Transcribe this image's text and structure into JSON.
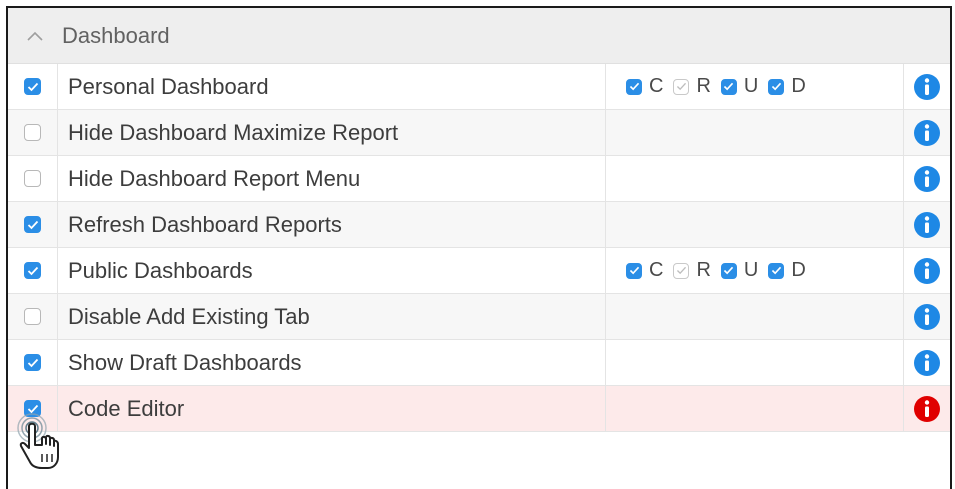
{
  "header": {
    "title": "Dashboard"
  },
  "crud_letters": {
    "c": "C",
    "r": "R",
    "u": "U",
    "d": "D"
  },
  "colors": {
    "accent": "#2b8ee6",
    "info": "#1e88e5",
    "alert": "#e00000",
    "highlight_row": "#fdeaea"
  },
  "rows": [
    {
      "label": "Personal Dashboard",
      "checked": true,
      "crud": {
        "c": true,
        "r": "disabled-checked",
        "u": true,
        "d": true
      },
      "info": "info"
    },
    {
      "label": "Hide Dashboard Maximize Report",
      "checked": false,
      "info": "info"
    },
    {
      "label": "Hide Dashboard Report Menu",
      "checked": false,
      "info": "info"
    },
    {
      "label": "Refresh Dashboard Reports",
      "checked": true,
      "info": "info"
    },
    {
      "label": "Public Dashboards",
      "checked": true,
      "crud": {
        "c": true,
        "r": "disabled-checked",
        "u": true,
        "d": true
      },
      "info": "info"
    },
    {
      "label": "Disable Add Existing Tab",
      "checked": false,
      "info": "info"
    },
    {
      "label": "Show Draft Dashboards",
      "checked": true,
      "info": "info"
    },
    {
      "label": "Code Editor",
      "checked": true,
      "info": "alert",
      "highlight": true
    }
  ]
}
